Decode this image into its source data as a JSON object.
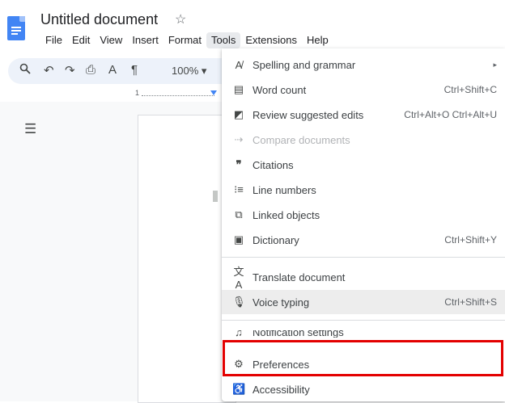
{
  "header": {
    "title": "Untitled document",
    "star_icon": "star-icon",
    "menu": [
      "File",
      "Edit",
      "View",
      "Insert",
      "Format",
      "Tools",
      "Extensions",
      "Help"
    ],
    "active_menu": "Tools"
  },
  "toolbar": {
    "icons": [
      "search-icon",
      "undo-icon",
      "redo-icon",
      "print-icon",
      "spellcheck-icon",
      "paint-format-icon"
    ],
    "zoom": "100%"
  },
  "ruler": {
    "mark": "1"
  },
  "tools_menu": {
    "items": [
      {
        "label": "Spelling and grammar",
        "shortcut": "",
        "icon": "spellcheck-icon",
        "submenu": true
      },
      {
        "label": "Word count",
        "shortcut": "Ctrl+Shift+C",
        "icon": "word-count-icon"
      },
      {
        "label": "Review suggested edits",
        "shortcut": "Ctrl+Alt+O Ctrl+Alt+U",
        "icon": "review-edits-icon"
      },
      {
        "label": "Compare documents",
        "shortcut": "",
        "icon": "compare-icon",
        "disabled": true
      },
      {
        "label": "Citations",
        "shortcut": "",
        "icon": "quote-icon"
      },
      {
        "label": "Line numbers",
        "shortcut": "",
        "icon": "line-numbers-icon"
      },
      {
        "label": "Linked objects",
        "shortcut": "",
        "icon": "linked-objects-icon"
      },
      {
        "label": "Dictionary",
        "shortcut": "Ctrl+Shift+Y",
        "icon": "dictionary-icon"
      },
      {
        "label": "Translate document",
        "shortcut": "",
        "icon": "translate-icon"
      },
      {
        "label": "Voice typing",
        "shortcut": "Ctrl+Shift+S",
        "icon": "microphone-icon"
      },
      {
        "label": "Notification settings",
        "shortcut": "",
        "icon": "bell-icon"
      },
      {
        "label": "Preferences",
        "shortcut": "",
        "icon": "preferences-icon"
      },
      {
        "label": "Accessibility",
        "shortcut": "",
        "icon": "accessibility-icon"
      }
    ]
  },
  "colors": {
    "highlight": "#e30000",
    "doc_blue": "#4285f4",
    "toolbar_bg": "#edf2fa"
  }
}
